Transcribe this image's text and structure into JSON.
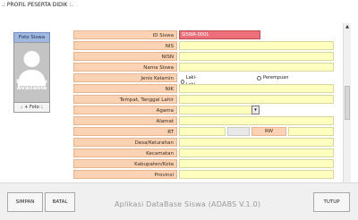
{
  "window": {
    "title": ".: PROFIL PESERTA DIDIK :."
  },
  "photo": {
    "header": "Foto Siswa",
    "placeholder_line1": "No Image",
    "placeholder_line2": "Available",
    "button": ".: + Foto :."
  },
  "form": {
    "fields": [
      {
        "label": "ID Siswa",
        "value": "SISWA-0001"
      },
      {
        "label": "NIS",
        "value": ""
      },
      {
        "label": "NISN",
        "value": ""
      },
      {
        "label": "Nama Siswa",
        "value": ""
      },
      {
        "label": "Jenis Kelamin",
        "options": [
          "Laki-Laki",
          "Perempuan"
        ]
      },
      {
        "label": "NIK",
        "value": ""
      },
      {
        "label": "Tempat, Tanggal Lahir",
        "value": ""
      },
      {
        "label": "Agama",
        "value": ""
      },
      {
        "label": "Alamat",
        "value": ""
      },
      {
        "label": "RT",
        "value": "",
        "rw_label": "RW"
      },
      {
        "label": "Desa/Kelurahan",
        "value": ""
      },
      {
        "label": "Kecamatan",
        "value": ""
      },
      {
        "label": "Kabupaten/Kota",
        "value": ""
      },
      {
        "label": "Provinsi",
        "value": ""
      }
    ]
  },
  "footer": {
    "save": "SIMPAN",
    "cancel": "BATAL",
    "app_title": "Aplikasi DataBase Siswa (ADABS V.1.0)",
    "close": "TUTUP"
  },
  "colors": {
    "label_bg": "#fbd3b4",
    "field_bg": "#ffffc0",
    "id_field_bg": "#ec6f7b"
  }
}
